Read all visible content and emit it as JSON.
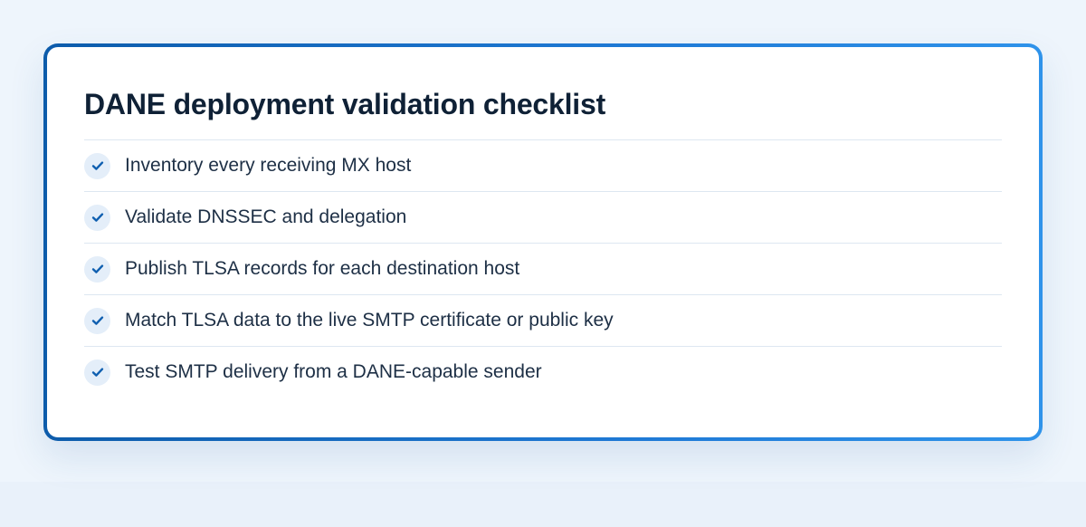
{
  "card": {
    "title": "DANE deployment validation checklist",
    "items": [
      {
        "label": "Inventory every receiving MX host",
        "checked": true,
        "icon": "checkmark-icon"
      },
      {
        "label": "Validate DNSSEC and delegation",
        "checked": true,
        "icon": "checkmark-icon"
      },
      {
        "label": "Publish TLSA records for each destination host",
        "checked": true,
        "icon": "checkmark-icon"
      },
      {
        "label": "Match TLSA data to the live SMTP certificate or public key",
        "checked": true,
        "icon": "checkmark-icon"
      },
      {
        "label": "Test SMTP delivery from a DANE-capable sender",
        "checked": true,
        "icon": "checkmark-icon"
      }
    ]
  },
  "colors": {
    "page_background": "#eef5fc",
    "card_border_start": "#0d5cab",
    "card_border_end": "#2f93ea",
    "title_text": "#0f2136",
    "item_text": "#1d2f45",
    "check_badge": "#e4eef9",
    "check_mark": "#0f5fb0",
    "divider": "#dde7f1"
  }
}
